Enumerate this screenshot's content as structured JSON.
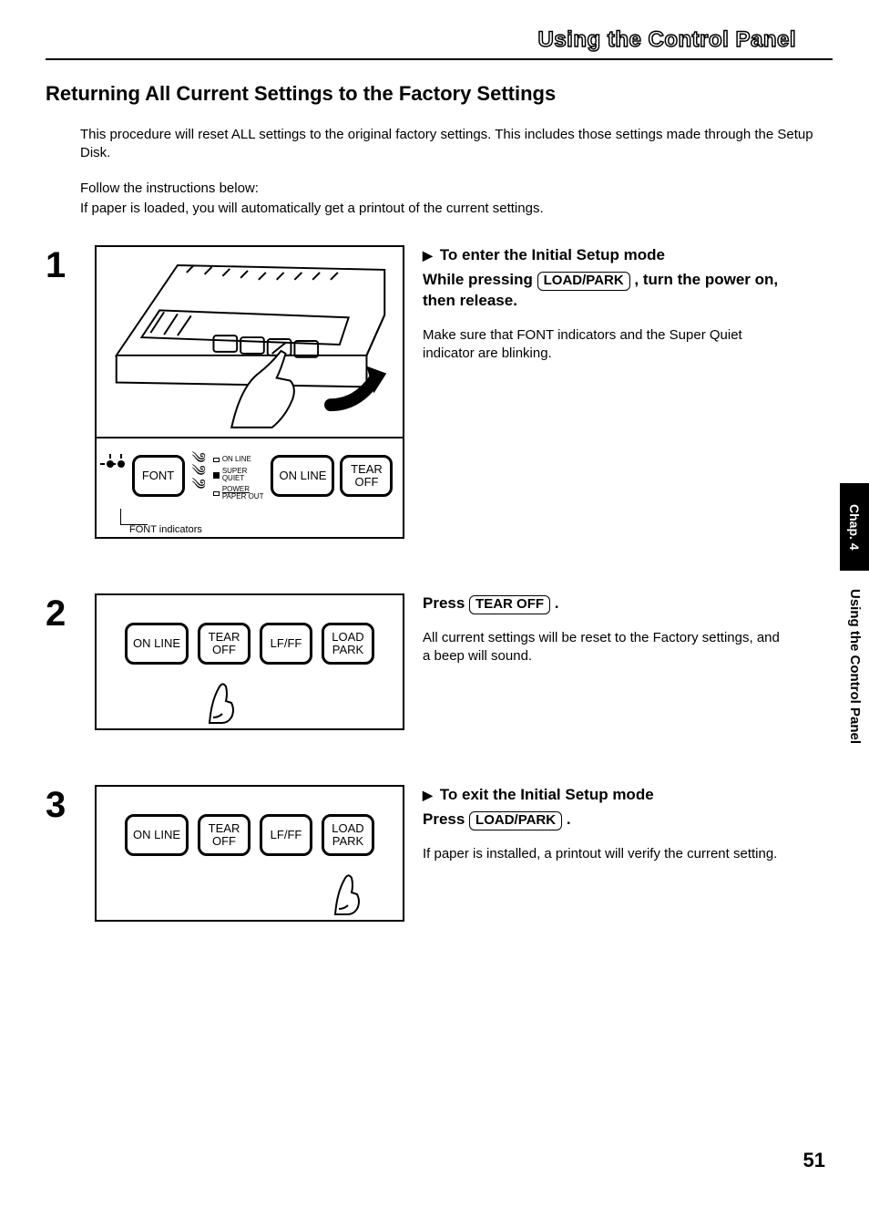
{
  "page": {
    "section_title": "Using the Control Panel",
    "subtitle": "Returning All Current Settings to the Factory Settings",
    "intro1": "This procedure will reset ALL settings to the original factory settings. This includes those settings made through the Setup Disk.",
    "intro2": "Follow the instructions below:",
    "intro3": "If paper is loaded, you will automatically get a printout of the current settings.",
    "page_number": "51",
    "side_tab": "Chap. 4",
    "side_tab2": "Using the Control Panel"
  },
  "buttons": {
    "font": "FONT",
    "online": "ON LINE",
    "tearoff_l1": "TEAR",
    "tearoff_l2": "OFF",
    "lfff": "LF/FF",
    "loadpark_l1": "LOAD",
    "loadpark_l2": "PARK",
    "loadpark_inline": "LOAD/PARK",
    "tearoff_inline": "TEAR OFF"
  },
  "leds": {
    "online": "ON LINE",
    "super": "SUPER",
    "quiet": "QUIET",
    "power": "POWER",
    "paperout": "PAPER OUT",
    "font_indicators": "FONT indicators"
  },
  "steps": {
    "s1": {
      "num": "1",
      "lead": "To enter the Initial Setup mode",
      "instr_pre": "While pressing ",
      "instr_post": " , turn the power on, then release.",
      "body": "Make sure that FONT indicators and the Super Quiet indicator are blinking."
    },
    "s2": {
      "num": "2",
      "instr_pre": "Press ",
      "instr_post": " .",
      "body": "All current settings will be reset to the Factory settings, and a beep will sound."
    },
    "s3": {
      "num": "3",
      "lead": "To exit the Initial Setup mode",
      "instr_pre": "Press ",
      "instr_post": " .",
      "body": "If paper is installed, a printout will verify the current setting."
    }
  }
}
